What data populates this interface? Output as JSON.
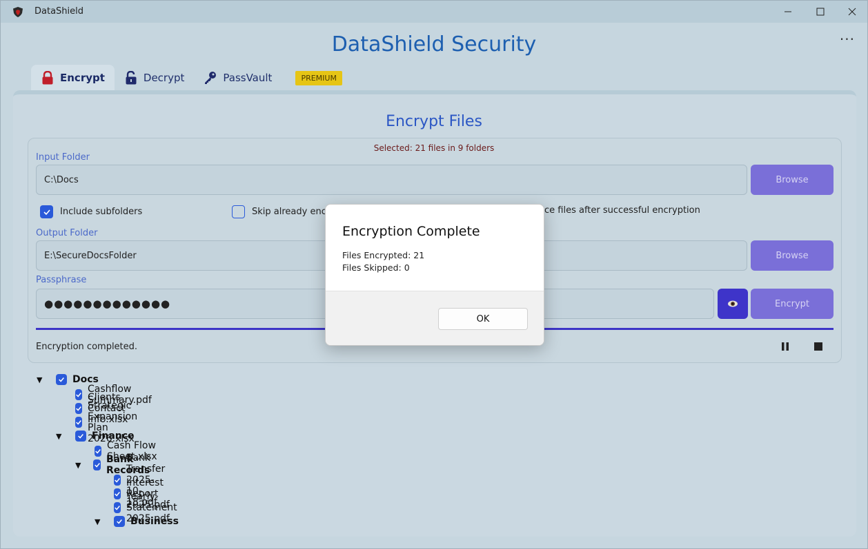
{
  "window": {
    "title": "DataShield",
    "controls": {
      "minimize": "minimize",
      "maximize": "maximize",
      "close": "close"
    }
  },
  "header": {
    "app_title": "DataShield Security",
    "more_label": "···"
  },
  "tabs": [
    {
      "label": "Encrypt",
      "icon": "lock-icon",
      "active": true
    },
    {
      "label": "Decrypt",
      "icon": "unlock-icon",
      "active": false
    },
    {
      "label": "PassVault",
      "icon": "key-icon",
      "active": false
    }
  ],
  "premium_badge": "PREMIUM",
  "encrypt": {
    "section_title": "Encrypt Files",
    "selected_info": "Selected: 21 files in 9 folders",
    "input_folder": {
      "label": "Input Folder",
      "value": "C:\\Docs",
      "browse_label": "Browse"
    },
    "options": {
      "include_subfolders": {
        "label": "Include subfolders",
        "checked": true
      },
      "skip_encrypted": {
        "label": "Skip already encryp",
        "checked": false
      },
      "replace_files": {
        "label": "ce files after successful encryption"
      }
    },
    "output_folder": {
      "label": "Output Folder",
      "value": "E:\\SecureDocsFolder",
      "browse_label": "Browse"
    },
    "passphrase": {
      "label": "Passphrase",
      "value": "●●●●●●●●●●●●●",
      "encrypt_label": "Encrypt"
    },
    "status": "Encryption completed.",
    "progress_fraction": 1.0,
    "colors": {
      "accent": "#3d35c7",
      "button": "#7a6fd8",
      "checkbox": "#2a5ad9"
    }
  },
  "tree": [
    {
      "label": "Docs",
      "folder": true,
      "expanded": true,
      "depth": 0
    },
    {
      "label": "Cashflow Summary.pdf",
      "folder": false,
      "depth": 1
    },
    {
      "label": "Clients Contact Info.xlsx",
      "folder": false,
      "depth": 1
    },
    {
      "label": "Strategic Expansion Plan 2026.xlsx",
      "folder": false,
      "depth": 1
    },
    {
      "label": "Finance",
      "folder": true,
      "expanded": true,
      "depth": 1
    },
    {
      "label": "Cash Flow Sheet.xlsx",
      "folder": false,
      "depth": 2
    },
    {
      "label": "Bank Records",
      "folder": true,
      "expanded": true,
      "depth": 2
    },
    {
      "label": "Bank Transfer 2025-10-18.pdf",
      "folder": false,
      "depth": 3
    },
    {
      "label": "Interest Report 2025.pdf",
      "folder": false,
      "depth": 3
    },
    {
      "label": "Yearly Statement 2025.pdf",
      "folder": false,
      "depth": 3
    },
    {
      "label": "Business",
      "folder": true,
      "expanded": true,
      "depth": 3
    }
  ],
  "dialog": {
    "title": "Encryption Complete",
    "lines": [
      "Files Encrypted: 21",
      "Files Skipped: 0"
    ],
    "ok_label": "OK"
  }
}
